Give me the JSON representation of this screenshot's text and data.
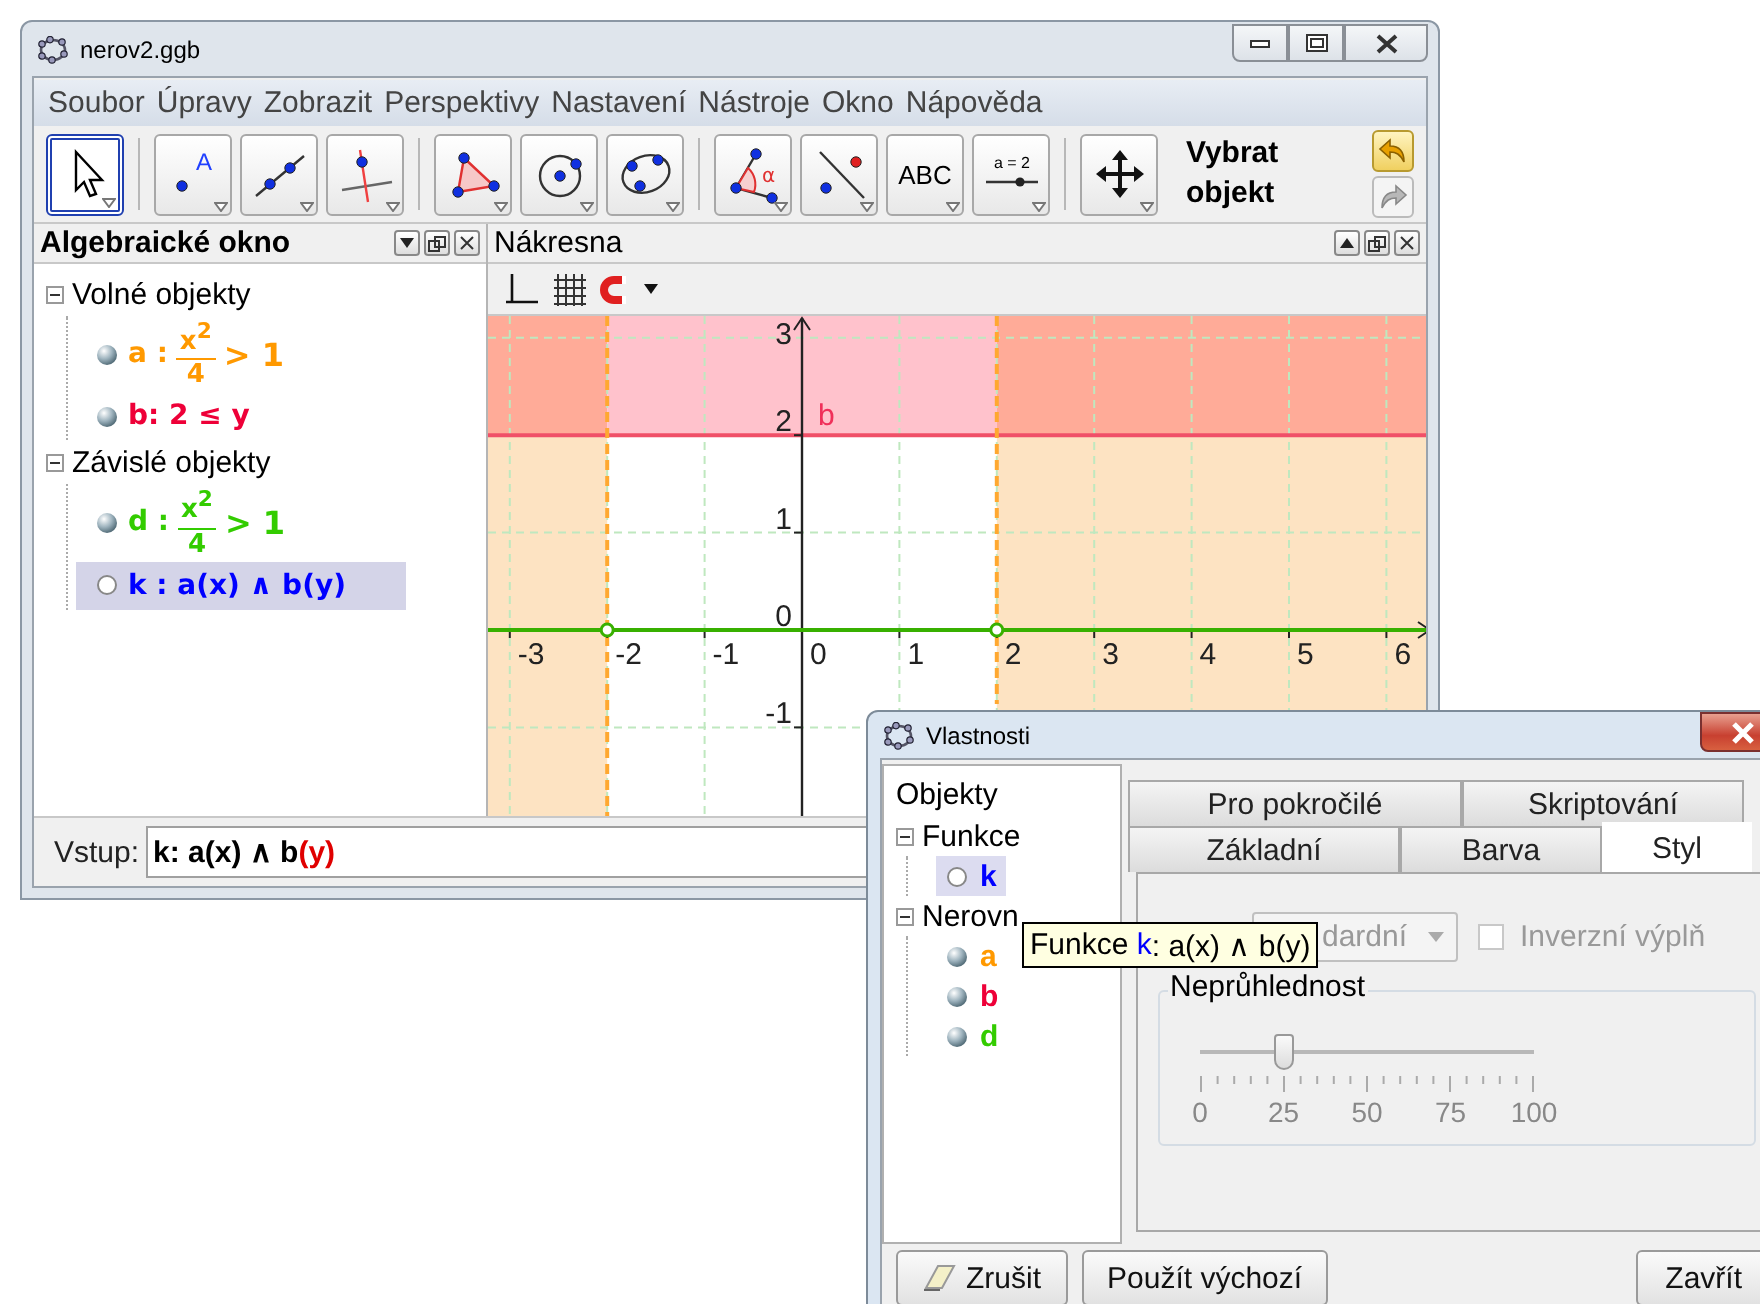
{
  "main_window": {
    "title": "nerov2.ggb"
  },
  "menu": [
    "Soubor",
    "Úpravy",
    "Zobrazit",
    "Perspektivy",
    "Nastavení",
    "Nástroje",
    "Okno",
    "Nápověda"
  ],
  "toolbar": {
    "tools": [
      {
        "kind": "move",
        "selected": true
      },
      {
        "kind": "point",
        "label": "A",
        "selected": false
      },
      {
        "kind": "line",
        "selected": false
      },
      {
        "kind": "perpendicular",
        "selected": false
      },
      {
        "kind": "polygon",
        "selected": false
      },
      {
        "kind": "circle",
        "selected": false
      },
      {
        "kind": "conic",
        "selected": false
      },
      {
        "kind": "angle",
        "label": "α",
        "selected": false
      },
      {
        "kind": "reflect",
        "selected": false
      },
      {
        "kind": "text",
        "label": "ABC",
        "selected": false
      },
      {
        "kind": "slider",
        "label": "a = 2",
        "selected": false
      },
      {
        "kind": "move_view",
        "selected": false
      }
    ],
    "tool_name": "Vybrat objekt"
  },
  "algebra_view": {
    "title": "Algebraické okno",
    "groups": [
      {
        "label": "Volné objekty",
        "expanded": true,
        "children": [
          {
            "kind": "fraction",
            "label": "a :",
            "numerator": "x$^{2}$",
            "denominator": "4",
            "relation": "> 1",
            "color": "#ff9900",
            "visible": true,
            "selected": false
          },
          {
            "kind": "plain",
            "text": "b: 2 ≤ y",
            "color": "#ee0038",
            "visible": true,
            "selected": false
          }
        ]
      },
      {
        "label": "Závislé objekty",
        "expanded": true,
        "children": [
          {
            "kind": "fraction",
            "label": "d :",
            "numerator": "x$^{2}$",
            "denominator": "4",
            "relation": "> 1",
            "color": "#33cc00",
            "visible": true,
            "selected": false
          },
          {
            "kind": "plain",
            "text": "k : a(x) ∧ b(y)",
            "color": "#0000ff",
            "visible": false,
            "selected": true
          }
        ]
      }
    ]
  },
  "graphics_view": {
    "title": "Nákresna",
    "x_labels": [
      "-3",
      "-2",
      "-1",
      "0",
      "1",
      "2",
      "3",
      "4",
      "5",
      "6"
    ],
    "y_labels": [
      "3",
      "2",
      "1",
      "0",
      "-1"
    ],
    "object_label": "b"
  },
  "input_bar": {
    "label": "Vstup:",
    "segments": [
      {
        "text": "k: a(x) ∧ b",
        "color": "#000000"
      },
      {
        "text": "(y)",
        "color": "#e00000"
      }
    ]
  },
  "properties_dialog": {
    "title": "Vlastnosti",
    "tree": {
      "root": "Objekty",
      "groups": [
        {
          "label": "Funkce",
          "expanded": true,
          "children": [
            {
              "name": "k",
              "color": "#0000ff",
              "visible": false,
              "selected": true
            }
          ]
        },
        {
          "label": "Nerovn",
          "expanded": true,
          "children": [
            {
              "name": "a",
              "color": "#ff9900",
              "visible": true,
              "selected": false
            },
            {
              "name": "b",
              "color": "#ee0038",
              "visible": true,
              "selected": false
            },
            {
              "name": "d",
              "color": "#33cc00",
              "visible": true,
              "selected": false
            }
          ]
        }
      ]
    },
    "tab_rows": [
      [
        {
          "label": "Pro pokročilé",
          "selected": false
        },
        {
          "label": "Skriptování",
          "selected": false
        }
      ],
      [
        {
          "label": "Základní",
          "selected": false
        },
        {
          "label": "Barva",
          "selected": false
        },
        {
          "label": "Styl",
          "selected": true
        }
      ]
    ],
    "fill_style": {
      "value": "dardní",
      "disabled": true
    },
    "inverse_fill": {
      "label": "Inverzní výplň",
      "checked": false,
      "disabled": true
    },
    "opacity": {
      "label": "Neprůhlednost",
      "level": 0.25,
      "tick_labels": [
        "0",
        "25",
        "50",
        "75",
        "100"
      ]
    },
    "buttons": [
      {
        "kind": "icon",
        "label": "Zrušit"
      },
      {
        "kind": "plain",
        "label": "Použít výchozí"
      },
      {
        "kind": "plain",
        "label": "Zavřít"
      }
    ],
    "tooltip": [
      {
        "text": "Funkce ",
        "color": "#000000"
      },
      {
        "text": "k",
        "color": "#0000ff"
      },
      {
        "text": ": a(x) ∧ b(y)",
        "color": "#000000"
      }
    ]
  }
}
